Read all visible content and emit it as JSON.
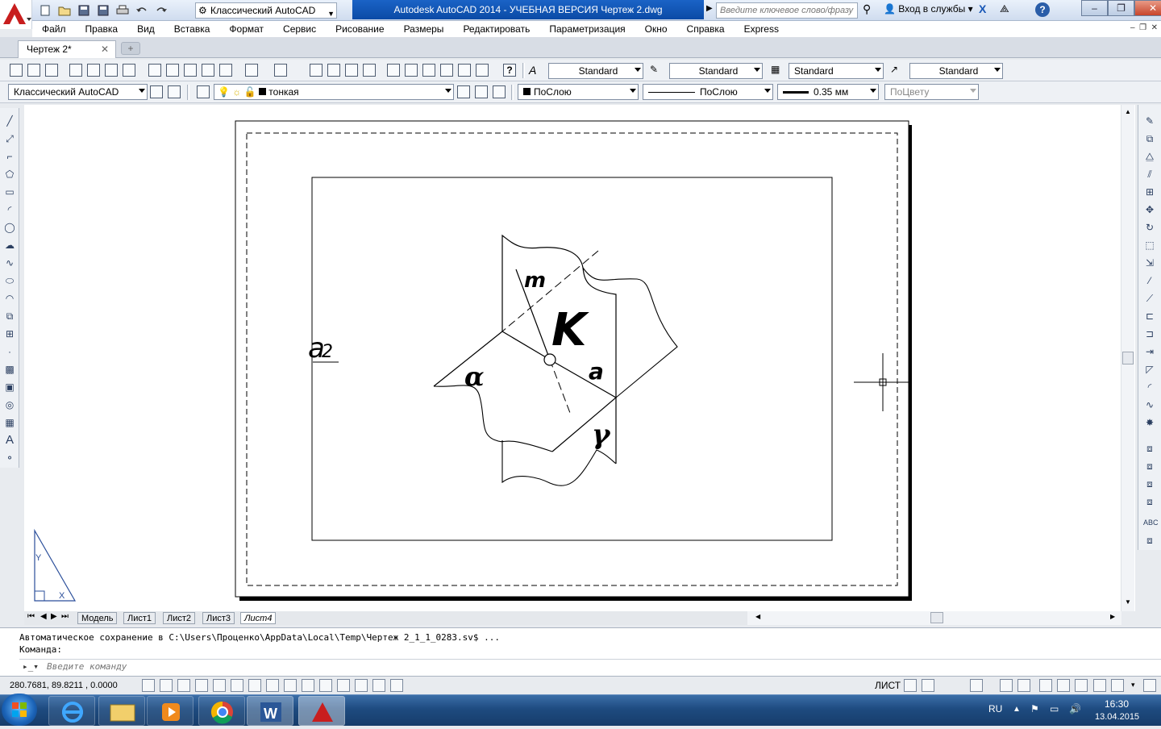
{
  "title_bar": {
    "workspace": "Классический AutoCAD",
    "title": "Autodesk AutoCAD 2014 - УЧЕБНАЯ ВЕРСИЯ    Чертеж 2.dwg",
    "search_placeholder": "Введите ключевое слово/фразу",
    "signin": "Вход в службы"
  },
  "menu": [
    "Файл",
    "Правка",
    "Вид",
    "Вставка",
    "Формат",
    "Сервис",
    "Рисование",
    "Размеры",
    "Редактировать",
    "Параметризация",
    "Окно",
    "Справка",
    "Express"
  ],
  "file_tab": {
    "label": "Чертеж 2*",
    "close": "✕"
  },
  "styles_toolbar": {
    "text_style": "Standard",
    "dim_style": "Standard",
    "table_style": "Standard",
    "mleader_style": "Standard"
  },
  "props_toolbar": {
    "workspace": "Классический AutoCAD",
    "layer": "тонкая",
    "color": "ПоСлою",
    "linetype": "ПоСлою",
    "lineweight": "0.35 мм",
    "plotstyle": "ПоЦвету"
  },
  "drawing": {
    "labels": {
      "m": "m",
      "K": "K",
      "a": "a",
      "alpha": "α",
      "gamma": "γ",
      "partial": "₂"
    }
  },
  "layout_tabs": [
    "Модель",
    "Лист1",
    "Лист2",
    "Лист3",
    "Лист4"
  ],
  "active_layout": "Лист4",
  "command": {
    "history": [
      "Автоматическое сохранение в C:\\Users\\Проценко\\AppData\\Local\\Temp\\Чертеж 2_1_1_0283.sv$ ...",
      "Команда:"
    ],
    "placeholder": "Введите команду"
  },
  "status": {
    "coords": "280.7681, 89.8211 , 0.0000",
    "sheet": "ЛИСТ"
  },
  "taskbar": {
    "lang": "RU",
    "time": "16:30",
    "date": "13.04.2015"
  },
  "colors": {
    "title_active": "#0b4aa6",
    "autocad_red": "#c81e1e"
  }
}
